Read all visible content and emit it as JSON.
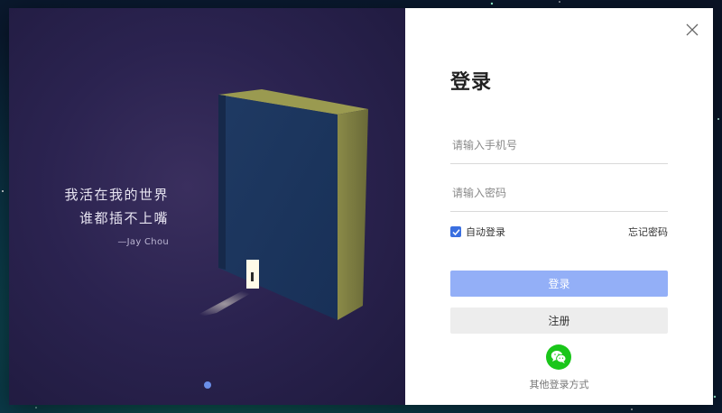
{
  "hero": {
    "quote_line1": "我活在我的世界",
    "quote_line2": "谁都插不上嘴",
    "author": "—Jay Chou",
    "carousel_active_index": 0
  },
  "login": {
    "title": "登录",
    "phone_placeholder": "请输入手机号",
    "phone_value": "",
    "password_placeholder": "请输入密码",
    "password_value": "",
    "auto_login_label": "自动登录",
    "auto_login_checked": true,
    "forgot_label": "忘记密码",
    "login_button": "登录",
    "register_button": "注册",
    "other_methods_label": "其他登录方式"
  },
  "icons": {
    "close": "close-icon",
    "checkbox": "check-icon",
    "wechat": "wechat-icon"
  },
  "colors": {
    "accent": "#3a6fe0",
    "login_button": "#93aff7",
    "register_button": "#ededed",
    "wechat": "#1ac61a",
    "hero_bg": "#2b2350"
  }
}
